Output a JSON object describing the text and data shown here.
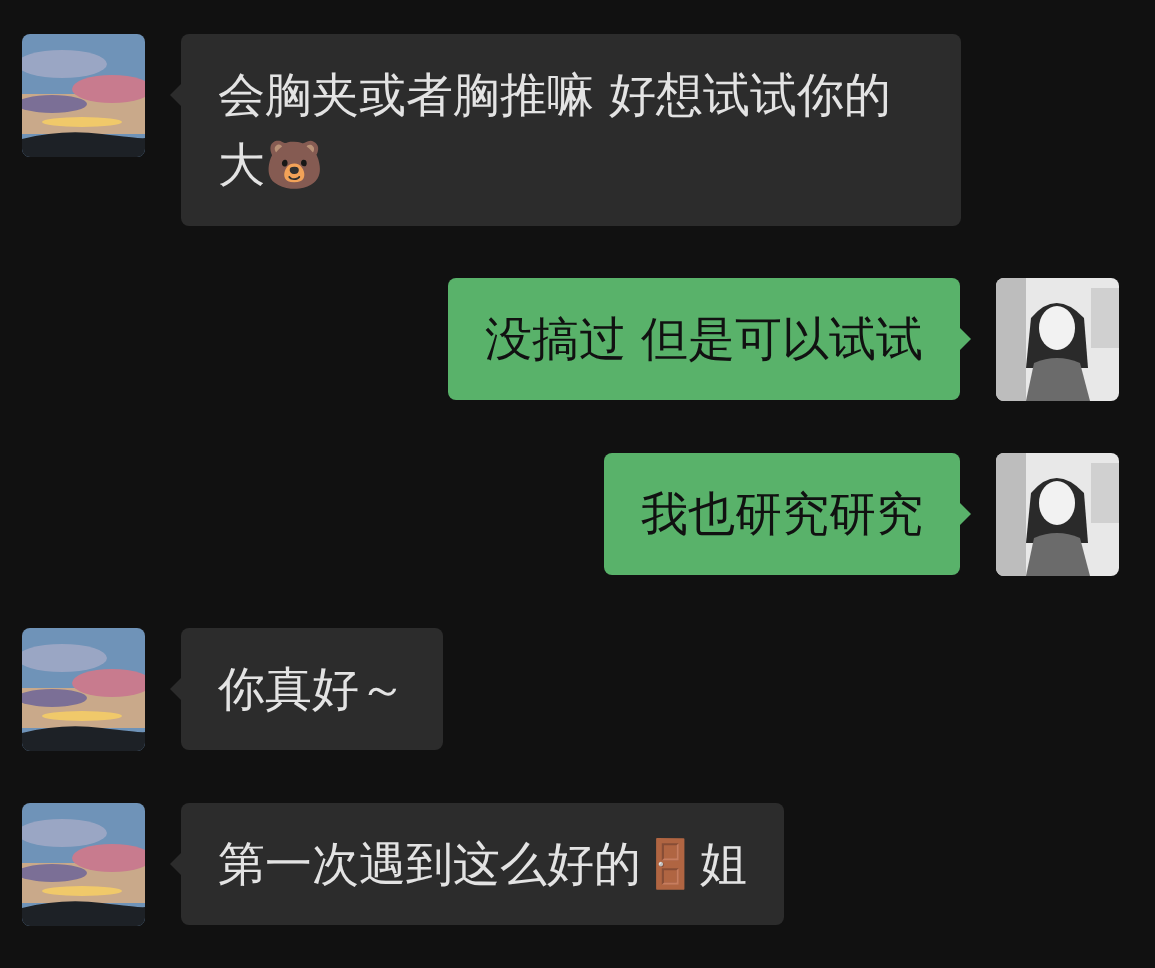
{
  "messages": [
    {
      "kind": "received",
      "text": "会胸夹或者胸推嘛 好想试试你的大🐻"
    },
    {
      "kind": "sent",
      "text": "没搞过 但是可以试试"
    },
    {
      "kind": "sent",
      "text": "我也研究研究"
    },
    {
      "kind": "received",
      "text": "你真好～"
    },
    {
      "kind": "received",
      "text": "第一次遇到这么好的🚪姐"
    }
  ]
}
